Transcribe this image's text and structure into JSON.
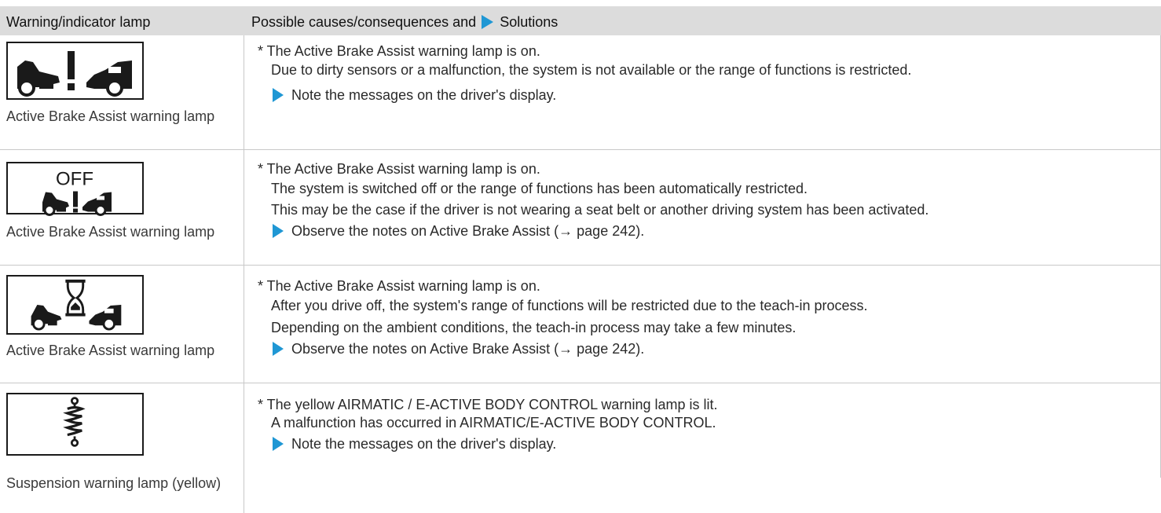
{
  "header": {
    "col1": "Warning/indicator lamp",
    "col2_prefix": "Possible causes/consequences and",
    "col2_suffix": "Solutions"
  },
  "rows": [
    {
      "lamp_name": "Active Brake Assist warning lamp",
      "icon": "collision-warning-icon",
      "lines": [
        "* The Active Brake Assist warning lamp is on.",
        "Due to dirty sensors or a malfunction, the system is not available or the range of functions is restricted."
      ],
      "solution": "Note the messages on the driver's display."
    },
    {
      "lamp_name": "Active Brake Assist warning lamp",
      "icon": "collision-warning-off-icon",
      "icon_text": "OFF",
      "lines": [
        "* The Active Brake Assist warning lamp is on.",
        "The system is switched off or the range of functions has been automatically restricted.",
        "This may be the case if the driver is not wearing a seat belt or another driving system has been activated."
      ],
      "solution": "Observe the notes on Active Brake Assist (→ page 242)."
    },
    {
      "lamp_name": "Active Brake Assist warning lamp",
      "icon": "collision-warning-hourglass-icon",
      "lines": [
        "* The Active Brake Assist warning lamp is on.",
        "After you drive off, the system's range of functions will be restricted due to the teach-in process.",
        "Depending on the ambient conditions, the teach-in process may take a few minutes."
      ],
      "solution": "Observe the notes on Active Brake Assist (→ page 242)."
    },
    {
      "lamp_name": "Suspension warning lamp (yellow)",
      "icon": "suspension-spring-icon",
      "lines": [
        "* The yellow AIRMATIC / E-ACTIVE BODY CONTROL warning lamp is lit.",
        "A malfunction has occurred in AIRMATIC/E-ACTIVE BODY CONTROL."
      ],
      "solution": "Note the messages on the driver's display."
    }
  ],
  "colors": {
    "accent": "#1f97d4",
    "header_bg": "#dcdcdc",
    "rule": "#c8c8c8"
  }
}
